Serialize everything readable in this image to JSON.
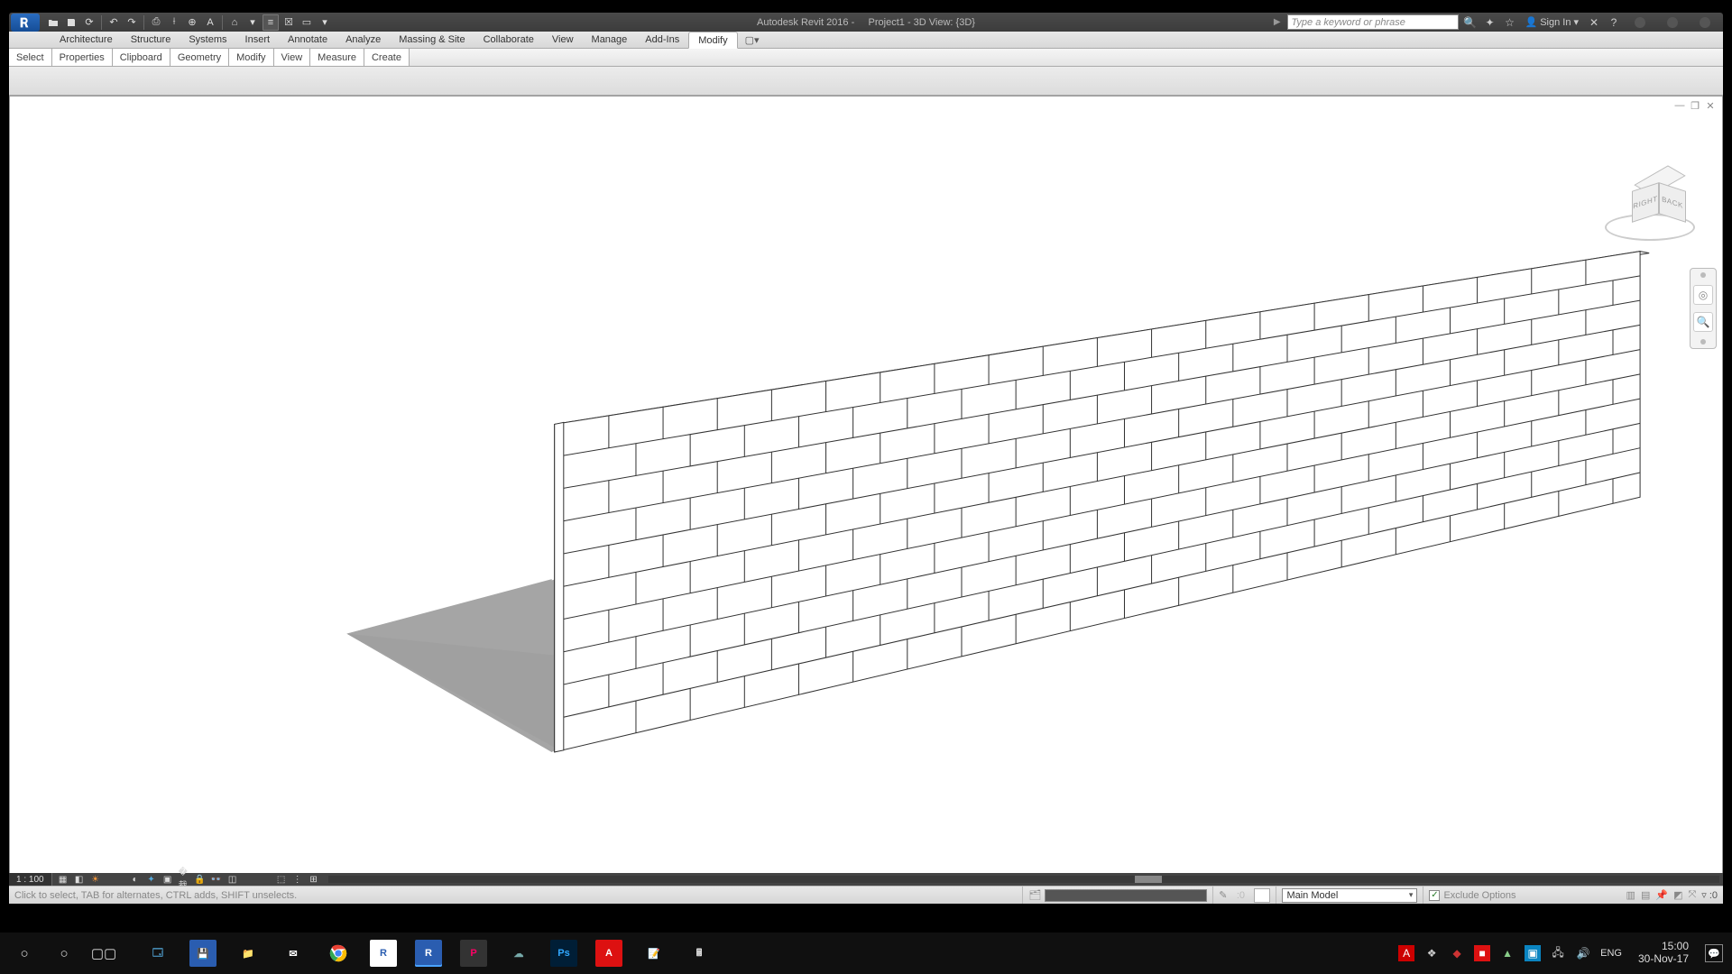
{
  "app": {
    "title_left": "Autodesk Revit 2016 -",
    "title_right": "Project1 - 3D View: {3D}",
    "search_placeholder": "Type a keyword or phrase",
    "signin": "Sign In"
  },
  "qat": [
    "open",
    "save",
    "sync",
    "undo",
    "redo",
    "measure",
    "dim",
    "text",
    "3d",
    "section",
    "thin",
    "close",
    "switch",
    "dropdown"
  ],
  "ribbon_tabs": [
    "Architecture",
    "Structure",
    "Systems",
    "Insert",
    "Annotate",
    "Analyze",
    "Massing & Site",
    "Collaborate",
    "View",
    "Manage",
    "Add-Ins",
    "Modify"
  ],
  "active_tab": "Modify",
  "panels": [
    "Select",
    "Properties",
    "Clipboard",
    "Geometry",
    "Modify",
    "View",
    "Measure",
    "Create"
  ],
  "view": {
    "scale": "1 : 100",
    "cube_right": "RIGHT",
    "cube_back": "BACK"
  },
  "status": {
    "hint": "Click to select, TAB for alternates, CTRL adds, SHIFT unselects.",
    "num": ":0",
    "model": "Main Model",
    "exclude": "Exclude Options",
    "filter": ":0"
  },
  "taskbar": {
    "lang": "ENG",
    "time": "15:00",
    "date": "30-Nov-17"
  }
}
